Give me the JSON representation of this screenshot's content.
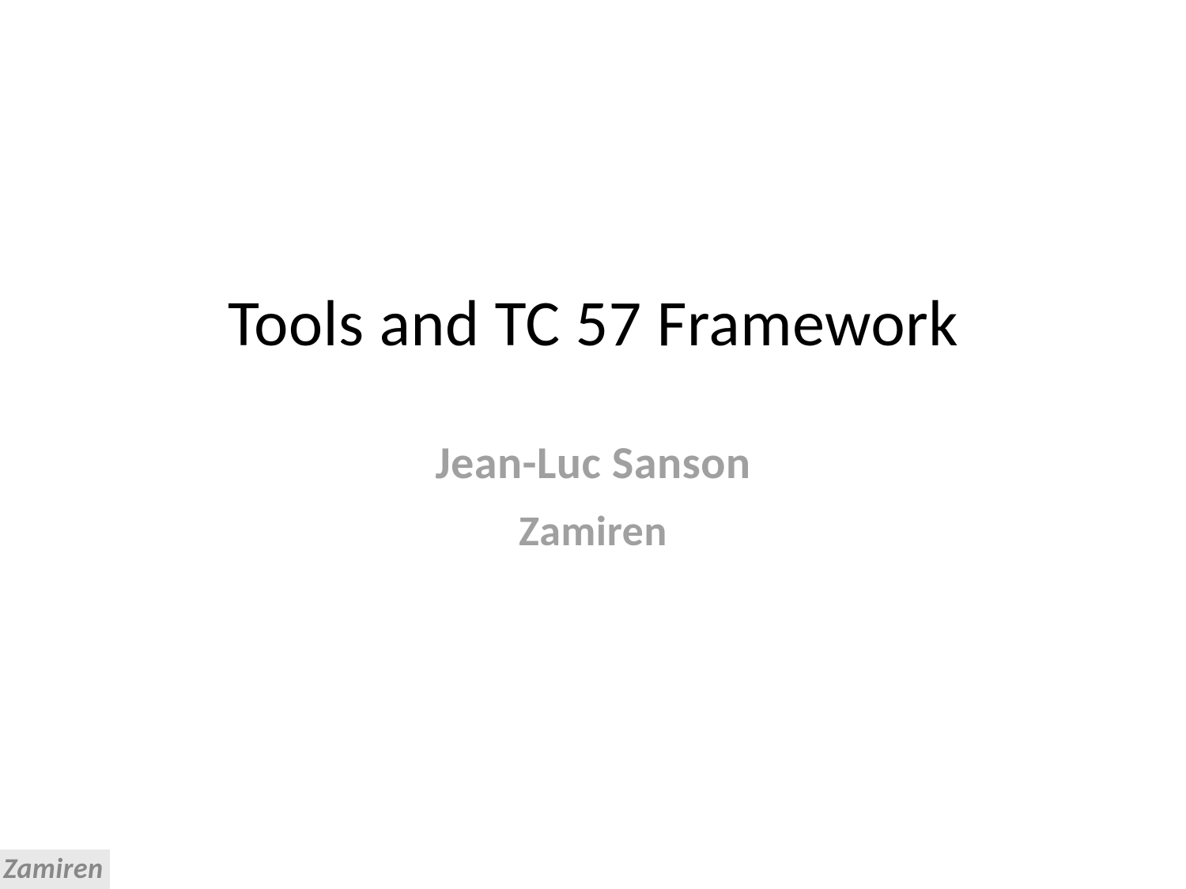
{
  "slide": {
    "title": "Tools and TC 57 Framework",
    "author": "Jean-Luc Sanson",
    "affiliation": "Zamiren"
  },
  "footer": {
    "logo_text": "Zamiren"
  }
}
